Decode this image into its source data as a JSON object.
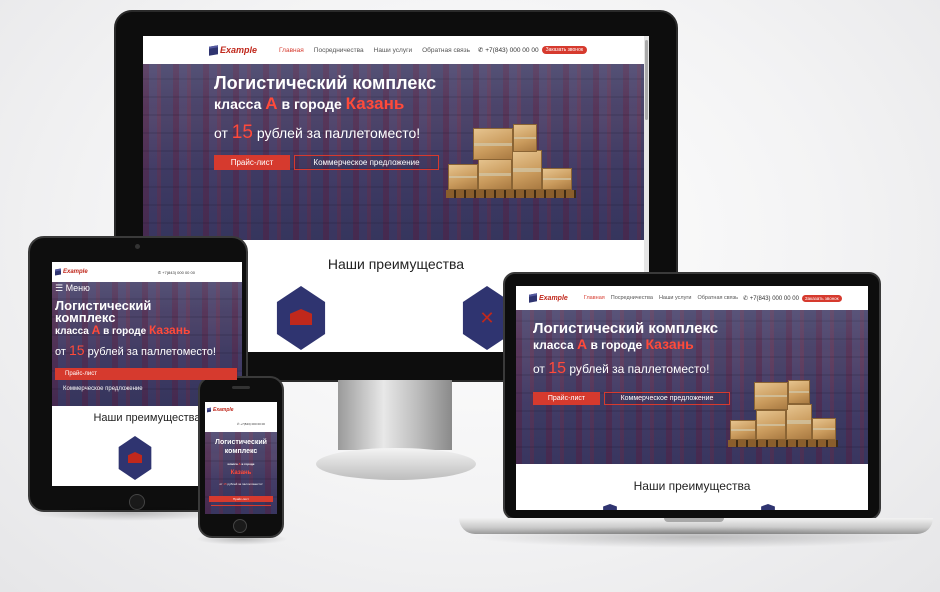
{
  "site": {
    "logo_text": "Example",
    "nav": [
      "Главная",
      "Посредничества",
      "Наши услуги",
      "Обратная связь"
    ],
    "phone": "+7(843) 000 00 00",
    "callback_label": "Заказать звонок",
    "menu_label": "Меню",
    "hero": {
      "title": "Логистический комплекс",
      "subtitle_prefix": "класса",
      "subtitle_class": "А",
      "subtitle_mid": "в городе",
      "subtitle_city": "Казань",
      "price_prefix": "от",
      "price_value": "15",
      "price_suffix": "рублей за паллетоместо!",
      "btn_price": "Прайс-лист",
      "btn_offer": "Коммерческое предложение"
    },
    "advantages_title": "Наши преимущества"
  },
  "colors": {
    "accent": "#d63a2e",
    "brand_dark": "#2f3470",
    "device_black": "#111111"
  }
}
